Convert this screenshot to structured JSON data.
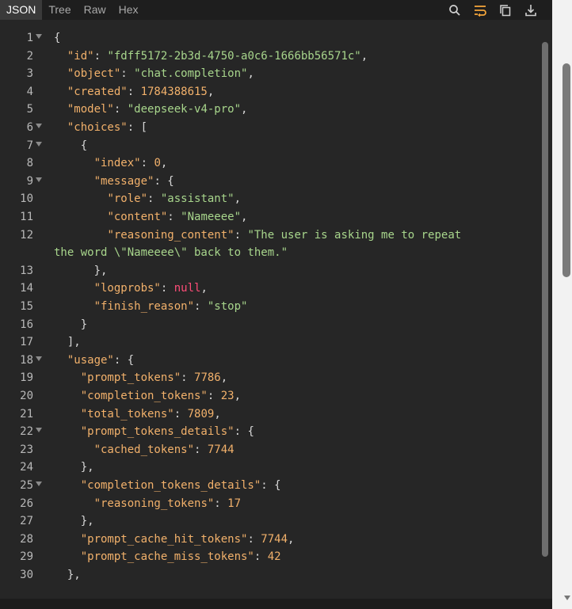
{
  "tabs": [
    "JSON",
    "Tree",
    "Raw",
    "Hex"
  ],
  "tools": [
    "search-icon",
    "wrap-icon",
    "copy-icon",
    "download-icon"
  ],
  "colors": {
    "key": "#f2b16b",
    "string": "#a8d68c",
    "number": "#f2b16b",
    "null": "#ff4d78",
    "punct": "#d8d8d8"
  },
  "rows": [
    {
      "n": "1",
      "fold": true,
      "t": [
        {
          "c": "p",
          "v": "{"
        }
      ]
    },
    {
      "n": "2",
      "t": [
        {
          "c": "p",
          "v": "  "
        },
        {
          "c": "k",
          "v": "\"id\""
        },
        {
          "c": "p",
          "v": ": "
        },
        {
          "c": "s",
          "v": "\"fdff5172-2b3d-4750-a0c6-1666bb56571c\""
        },
        {
          "c": "p",
          "v": ","
        }
      ]
    },
    {
      "n": "3",
      "t": [
        {
          "c": "p",
          "v": "  "
        },
        {
          "c": "k",
          "v": "\"object\""
        },
        {
          "c": "p",
          "v": ": "
        },
        {
          "c": "s",
          "v": "\"chat.completion\""
        },
        {
          "c": "p",
          "v": ","
        }
      ]
    },
    {
      "n": "4",
      "t": [
        {
          "c": "p",
          "v": "  "
        },
        {
          "c": "k",
          "v": "\"created\""
        },
        {
          "c": "p",
          "v": ": "
        },
        {
          "c": "n",
          "v": "1784388615"
        },
        {
          "c": "p",
          "v": ","
        }
      ]
    },
    {
      "n": "5",
      "t": [
        {
          "c": "p",
          "v": "  "
        },
        {
          "c": "k",
          "v": "\"model\""
        },
        {
          "c": "p",
          "v": ": "
        },
        {
          "c": "s",
          "v": "\"deepseek-v4-pro\""
        },
        {
          "c": "p",
          "v": ","
        }
      ]
    },
    {
      "n": "6",
      "fold": true,
      "t": [
        {
          "c": "p",
          "v": "  "
        },
        {
          "c": "k",
          "v": "\"choices\""
        },
        {
          "c": "p",
          "v": ": ["
        }
      ]
    },
    {
      "n": "7",
      "fold": true,
      "t": [
        {
          "c": "p",
          "v": "    {"
        }
      ]
    },
    {
      "n": "8",
      "t": [
        {
          "c": "p",
          "v": "      "
        },
        {
          "c": "k",
          "v": "\"index\""
        },
        {
          "c": "p",
          "v": ": "
        },
        {
          "c": "n",
          "v": "0"
        },
        {
          "c": "p",
          "v": ","
        }
      ]
    },
    {
      "n": "9",
      "fold": true,
      "t": [
        {
          "c": "p",
          "v": "      "
        },
        {
          "c": "k",
          "v": "\"message\""
        },
        {
          "c": "p",
          "v": ": {"
        }
      ]
    },
    {
      "n": "10",
      "t": [
        {
          "c": "p",
          "v": "        "
        },
        {
          "c": "k",
          "v": "\"role\""
        },
        {
          "c": "p",
          "v": ": "
        },
        {
          "c": "s",
          "v": "\"assistant\""
        },
        {
          "c": "p",
          "v": ","
        }
      ]
    },
    {
      "n": "11",
      "t": [
        {
          "c": "p",
          "v": "        "
        },
        {
          "c": "k",
          "v": "\"content\""
        },
        {
          "c": "p",
          "v": ": "
        },
        {
          "c": "s",
          "v": "\"Nameeee\""
        },
        {
          "c": "p",
          "v": ","
        }
      ]
    },
    {
      "n": "12",
      "t": [
        {
          "c": "p",
          "v": "        "
        },
        {
          "c": "k",
          "v": "\"reasoning_content\""
        },
        {
          "c": "p",
          "v": ": "
        },
        {
          "c": "s",
          "v": "\"The user is asking me to repeat"
        }
      ]
    },
    {
      "n": "",
      "t": [
        {
          "c": "s",
          "v": "the word \\\"Nameeee\\\" back to them.\""
        }
      ]
    },
    {
      "n": "13",
      "t": [
        {
          "c": "p",
          "v": "      },"
        }
      ]
    },
    {
      "n": "14",
      "t": [
        {
          "c": "p",
          "v": "      "
        },
        {
          "c": "k",
          "v": "\"logprobs\""
        },
        {
          "c": "p",
          "v": ": "
        },
        {
          "c": "nul",
          "v": "null"
        },
        {
          "c": "p",
          "v": ","
        }
      ]
    },
    {
      "n": "15",
      "t": [
        {
          "c": "p",
          "v": "      "
        },
        {
          "c": "k",
          "v": "\"finish_reason\""
        },
        {
          "c": "p",
          "v": ": "
        },
        {
          "c": "s",
          "v": "\"stop\""
        }
      ]
    },
    {
      "n": "16",
      "t": [
        {
          "c": "p",
          "v": "    }"
        }
      ]
    },
    {
      "n": "17",
      "t": [
        {
          "c": "p",
          "v": "  ],"
        }
      ]
    },
    {
      "n": "18",
      "fold": true,
      "t": [
        {
          "c": "p",
          "v": "  "
        },
        {
          "c": "k",
          "v": "\"usage\""
        },
        {
          "c": "p",
          "v": ": {"
        }
      ]
    },
    {
      "n": "19",
      "t": [
        {
          "c": "p",
          "v": "    "
        },
        {
          "c": "k",
          "v": "\"prompt_tokens\""
        },
        {
          "c": "p",
          "v": ": "
        },
        {
          "c": "n",
          "v": "7786"
        },
        {
          "c": "p",
          "v": ","
        }
      ]
    },
    {
      "n": "20",
      "t": [
        {
          "c": "p",
          "v": "    "
        },
        {
          "c": "k",
          "v": "\"completion_tokens\""
        },
        {
          "c": "p",
          "v": ": "
        },
        {
          "c": "n",
          "v": "23"
        },
        {
          "c": "p",
          "v": ","
        }
      ]
    },
    {
      "n": "21",
      "t": [
        {
          "c": "p",
          "v": "    "
        },
        {
          "c": "k",
          "v": "\"total_tokens\""
        },
        {
          "c": "p",
          "v": ": "
        },
        {
          "c": "n",
          "v": "7809"
        },
        {
          "c": "p",
          "v": ","
        }
      ]
    },
    {
      "n": "22",
      "fold": true,
      "t": [
        {
          "c": "p",
          "v": "    "
        },
        {
          "c": "k",
          "v": "\"prompt_tokens_details\""
        },
        {
          "c": "p",
          "v": ": {"
        }
      ]
    },
    {
      "n": "23",
      "t": [
        {
          "c": "p",
          "v": "      "
        },
        {
          "c": "k",
          "v": "\"cached_tokens\""
        },
        {
          "c": "p",
          "v": ": "
        },
        {
          "c": "n",
          "v": "7744"
        }
      ]
    },
    {
      "n": "24",
      "t": [
        {
          "c": "p",
          "v": "    },"
        }
      ]
    },
    {
      "n": "25",
      "fold": true,
      "t": [
        {
          "c": "p",
          "v": "    "
        },
        {
          "c": "k",
          "v": "\"completion_tokens_details\""
        },
        {
          "c": "p",
          "v": ": {"
        }
      ]
    },
    {
      "n": "26",
      "t": [
        {
          "c": "p",
          "v": "      "
        },
        {
          "c": "k",
          "v": "\"reasoning_tokens\""
        },
        {
          "c": "p",
          "v": ": "
        },
        {
          "c": "n",
          "v": "17"
        }
      ]
    },
    {
      "n": "27",
      "t": [
        {
          "c": "p",
          "v": "    },"
        }
      ]
    },
    {
      "n": "28",
      "t": [
        {
          "c": "p",
          "v": "    "
        },
        {
          "c": "k",
          "v": "\"prompt_cache_hit_tokens\""
        },
        {
          "c": "p",
          "v": ": "
        },
        {
          "c": "n",
          "v": "7744"
        },
        {
          "c": "p",
          "v": ","
        }
      ]
    },
    {
      "n": "29",
      "t": [
        {
          "c": "p",
          "v": "    "
        },
        {
          "c": "k",
          "v": "\"prompt_cache_miss_tokens\""
        },
        {
          "c": "p",
          "v": ": "
        },
        {
          "c": "n",
          "v": "42"
        }
      ]
    },
    {
      "n": "30",
      "t": [
        {
          "c": "p",
          "v": "  },"
        }
      ]
    }
  ]
}
